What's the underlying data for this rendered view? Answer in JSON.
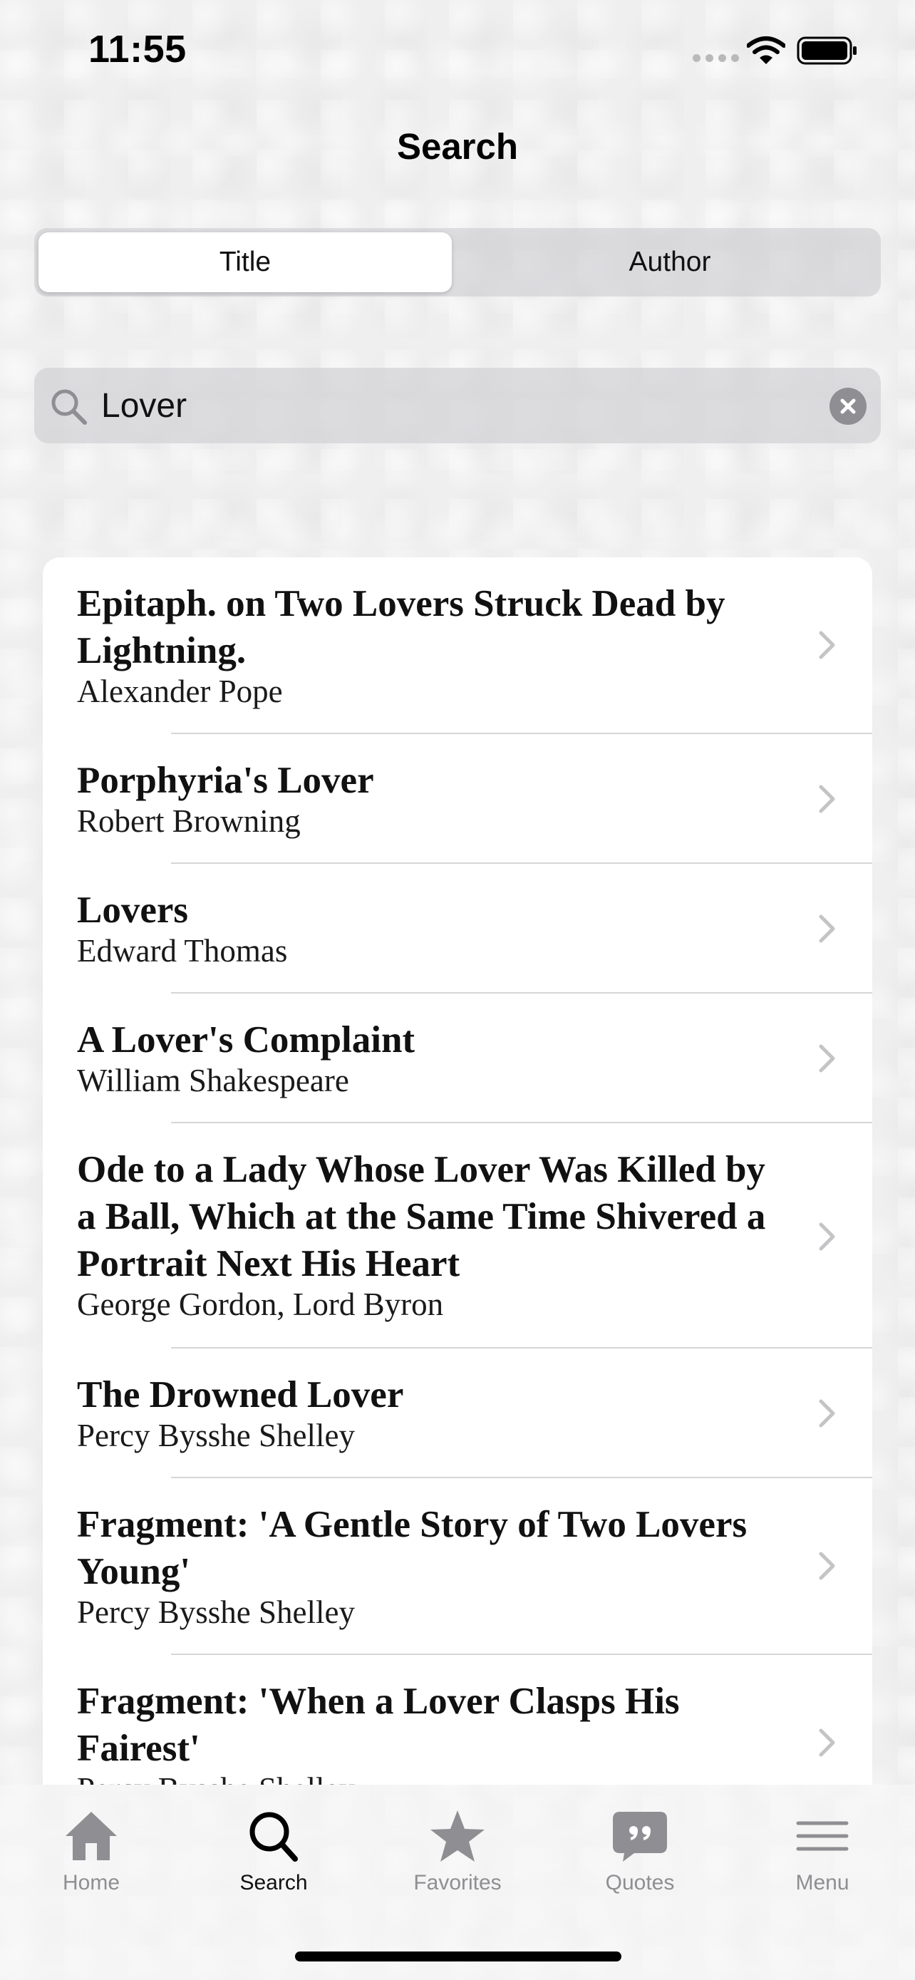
{
  "status_bar": {
    "time": "11:55"
  },
  "nav": {
    "title": "Search"
  },
  "segments": {
    "title_label": "Title",
    "author_label": "Author",
    "selected": "Title"
  },
  "search": {
    "value": "Lover",
    "placeholder": ""
  },
  "results": [
    {
      "title": "Epitaph. on Two Lovers Struck Dead by Lightning.",
      "author": "Alexander Pope"
    },
    {
      "title": "Porphyria's Lover",
      "author": "Robert Browning"
    },
    {
      "title": "Lovers",
      "author": "Edward Thomas"
    },
    {
      "title": "A Lover's Complaint",
      "author": "William Shakespeare"
    },
    {
      "title": "Ode to a Lady Whose Lover Was Killed by a Ball, Which at the Same Time Shivered a Portrait Next His Heart",
      "author": "George Gordon, Lord Byron"
    },
    {
      "title": "The Drowned Lover",
      "author": "Percy Bysshe Shelley"
    },
    {
      "title": "Fragment: 'A Gentle Story of Two Lovers Young'",
      "author": "Percy Bysshe Shelley"
    },
    {
      "title": "Fragment: 'When a Lover Clasps His Fairest'",
      "author": "Percy Bysshe Shelley"
    }
  ],
  "tab_bar": {
    "home": "Home",
    "search": "Search",
    "favorites": "Favorites",
    "quotes": "Quotes",
    "menu": "Menu",
    "active": "Search"
  },
  "icons": {
    "status": [
      "cellular-signal-icon",
      "wifi-icon",
      "battery-icon"
    ],
    "search": "search-icon",
    "clear": "clear-icon",
    "row": "chevron-right-icon",
    "tabs": [
      "home-icon",
      "search-icon",
      "star-icon",
      "quote-bubble-icon",
      "menu-lines-icon"
    ]
  },
  "colors": {
    "tab_inactive": "#8e8e93",
    "tab_active": "#111111",
    "chevron": "#c4c4c7"
  }
}
